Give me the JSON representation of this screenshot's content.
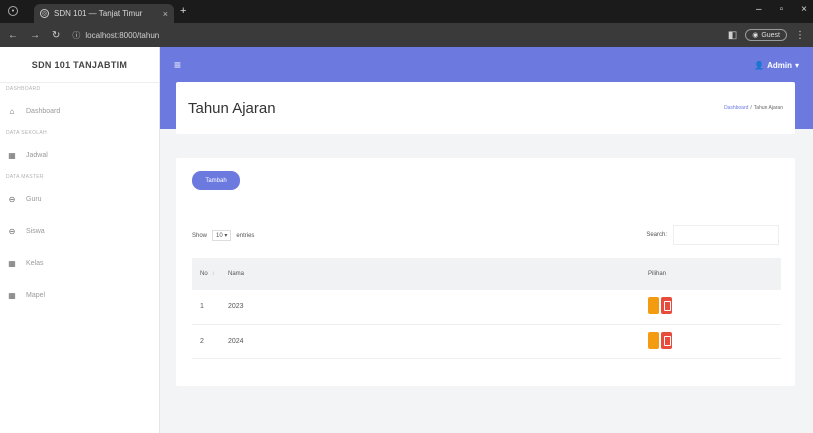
{
  "browser": {
    "tab_title": "SDN 101 — Tanjat Timur",
    "url": "localhost:8000/tahun",
    "guest_label": "Guest"
  },
  "sidebar": {
    "brand": "SDN 101 TANJABTIM",
    "sections": [
      {
        "heading": "DASHBOARD",
        "items": [
          {
            "label": "Dashboard",
            "icon": "home-icon"
          }
        ]
      },
      {
        "heading": "DATA SEKOLAH",
        "items": [
          {
            "label": "Jadwal",
            "icon": "grid-icon"
          }
        ]
      },
      {
        "heading": "DATA MASTER",
        "items": [
          {
            "label": "Guru",
            "icon": "user-icon"
          },
          {
            "label": "Siswa",
            "icon": "user-icon"
          },
          {
            "label": "Kelas",
            "icon": "grid-icon"
          },
          {
            "label": "Mapel",
            "icon": "grid-icon"
          }
        ]
      }
    ]
  },
  "topnav": {
    "user_label": "Admin"
  },
  "page": {
    "title": "Tahun Ajaran",
    "breadcrumb": {
      "parent": "Dashboard",
      "separator": "/",
      "current": "Tahun Ajaran"
    }
  },
  "toolbar": {
    "add_label": "Tambah"
  },
  "datatable": {
    "show_label": "Show",
    "page_size": "10",
    "entries_label": "entries",
    "search_label": "Search:",
    "columns": [
      "No",
      "Nama",
      "Pilihan"
    ],
    "rows": [
      {
        "no": "1",
        "nama": "2023"
      },
      {
        "no": "2",
        "nama": "2024"
      }
    ]
  },
  "colors": {
    "primary": "#6c7ae0",
    "edit": "#f39c12",
    "delete": "#e74c3c"
  }
}
